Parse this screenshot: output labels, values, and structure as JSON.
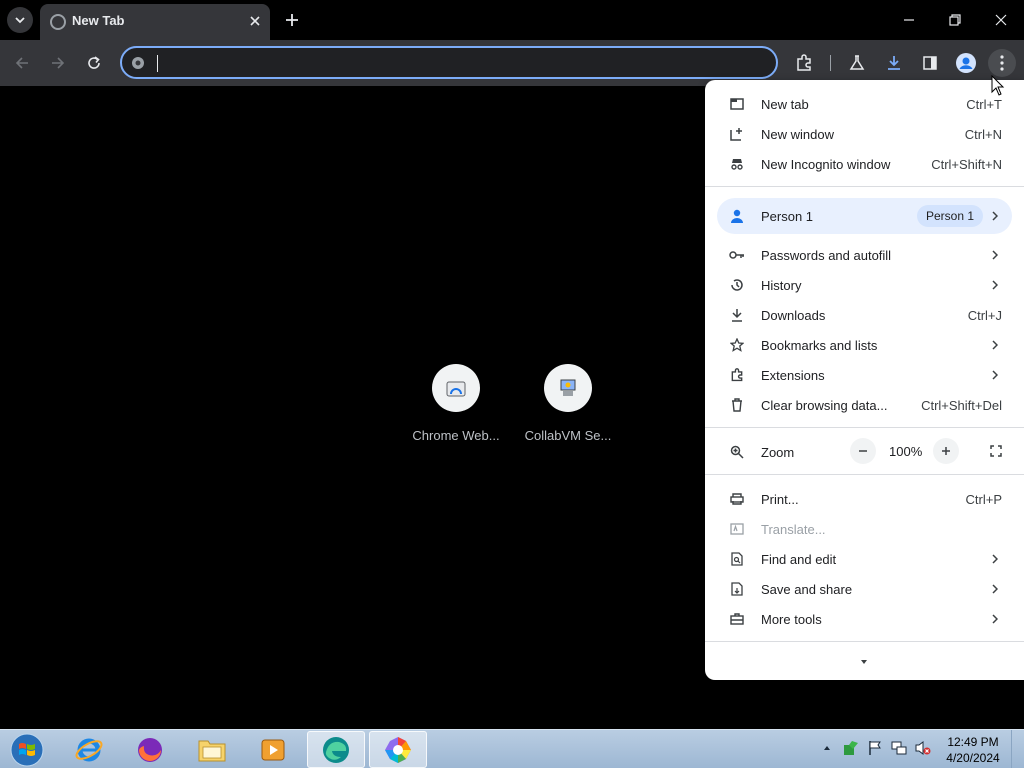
{
  "browser": {
    "tab": {
      "title": "New Tab"
    },
    "omnibox": {
      "value": "",
      "placeholder": ""
    }
  },
  "shortcuts": [
    {
      "label": "Chrome Web...",
      "icon": "chrome-web-store-icon"
    },
    {
      "label": "CollabVM Se...",
      "icon": "collabvm-icon"
    }
  ],
  "menu": {
    "new_tab": {
      "label": "New tab",
      "shortcut": "Ctrl+T"
    },
    "new_window": {
      "label": "New window",
      "shortcut": "Ctrl+N"
    },
    "new_incognito": {
      "label": "New Incognito window",
      "shortcut": "Ctrl+Shift+N"
    },
    "profile": {
      "label": "Person 1",
      "badge": "Person 1"
    },
    "passwords": {
      "label": "Passwords and autofill"
    },
    "history": {
      "label": "History"
    },
    "downloads": {
      "label": "Downloads",
      "shortcut": "Ctrl+J"
    },
    "bookmarks": {
      "label": "Bookmarks and lists"
    },
    "extensions": {
      "label": "Extensions"
    },
    "clear_data": {
      "label": "Clear browsing data...",
      "shortcut": "Ctrl+Shift+Del"
    },
    "zoom": {
      "label": "Zoom",
      "value": "100%",
      "minus": "−",
      "plus": "+"
    },
    "print": {
      "label": "Print...",
      "shortcut": "Ctrl+P"
    },
    "translate": {
      "label": "Translate..."
    },
    "find_edit": {
      "label": "Find and edit"
    },
    "save_share": {
      "label": "Save and share"
    },
    "more_tools": {
      "label": "More tools"
    }
  },
  "taskbar": {
    "clock_time": "12:49 PM",
    "clock_date": "4/20/2024"
  },
  "colors": {
    "accent": "#7cacf8",
    "toolbar": "#35363a",
    "menu_bg": "#ffffff",
    "profile_highlight": "#e8f0fe"
  }
}
